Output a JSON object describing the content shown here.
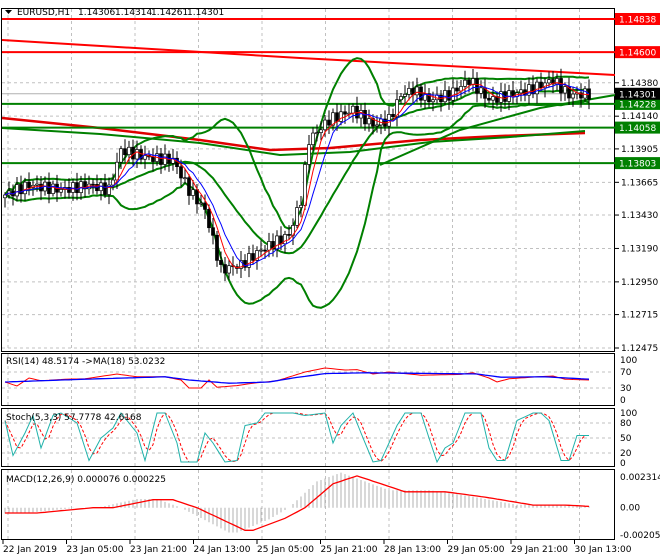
{
  "header": {
    "symbol": "EURUSD,H1",
    "open": "1.14306",
    "high": "1.14314",
    "low": "1.14261",
    "close": "1.14301"
  },
  "price_axis": {
    "ticks": [
      "1.14380",
      "1.14140",
      "1.13905",
      "1.13665",
      "1.13430",
      "1.13190",
      "1.12950",
      "1.12715",
      "1.12475"
    ],
    "tick_values": [
      1.1438,
      1.1414,
      1.13905,
      1.13665,
      1.1343,
      1.1319,
      1.1295,
      1.12715,
      1.12475
    ],
    "range": [
      1.12475,
      1.14838
    ]
  },
  "levels": [
    {
      "label": "1.14838",
      "value": 1.14838,
      "color": "#ff0000"
    },
    {
      "label": "1.14600",
      "value": 1.146,
      "color": "#ff0000"
    },
    {
      "label": "1.14228",
      "value": 1.14228,
      "color": "#008000"
    },
    {
      "label": "1.14058",
      "value": 1.14058,
      "color": "#008000"
    },
    {
      "label": "1.13803",
      "value": 1.13803,
      "color": "#008000"
    }
  ],
  "current_price": {
    "label": "1.14301",
    "value": 1.14301
  },
  "chart_data": {
    "type": "candlestick",
    "candle_count": 147,
    "close_keypoints": [
      [
        0,
        1.13574
      ],
      [
        6,
        1.13646
      ],
      [
        14,
        1.1361
      ],
      [
        21,
        1.13646
      ],
      [
        26,
        1.1361
      ],
      [
        29,
        1.13897
      ],
      [
        36,
        1.1384
      ],
      [
        42,
        1.13826
      ],
      [
        46,
        1.1361
      ],
      [
        50,
        1.13467
      ],
      [
        54,
        1.13036
      ],
      [
        59,
        1.13072
      ],
      [
        64,
        1.13179
      ],
      [
        71,
        1.13287
      ],
      [
        74,
        1.13538
      ],
      [
        76,
        1.13969
      ],
      [
        81,
        1.14113
      ],
      [
        87,
        1.14185
      ],
      [
        92,
        1.14077
      ],
      [
        96,
        1.14113
      ],
      [
        99,
        1.14292
      ],
      [
        102,
        1.14328
      ],
      [
        106,
        1.14256
      ],
      [
        111,
        1.14292
      ],
      [
        116,
        1.144
      ],
      [
        121,
        1.14256
      ],
      [
        126,
        1.14292
      ],
      [
        131,
        1.14328
      ],
      [
        137,
        1.144
      ],
      [
        141,
        1.14292
      ],
      [
        146,
        1.14301
      ]
    ],
    "rsi": {
      "label": "RSI(14) 48.5174  ->MA(18) 53.0232",
      "levels": [
        "100",
        "70",
        "30",
        "0"
      ],
      "values": [
        [
          0,
          45
        ],
        [
          3,
          35
        ],
        [
          6,
          55
        ],
        [
          9,
          48
        ],
        [
          15,
          52
        ],
        [
          20,
          53
        ],
        [
          28,
          65
        ],
        [
          33,
          58
        ],
        [
          40,
          58
        ],
        [
          44,
          50
        ],
        [
          46,
          30
        ],
        [
          49,
          30
        ],
        [
          51,
          50
        ],
        [
          53,
          32
        ],
        [
          58,
          36
        ],
        [
          62,
          42
        ],
        [
          68,
          48
        ],
        [
          75,
          70
        ],
        [
          80,
          80
        ],
        [
          85,
          75
        ],
        [
          88,
          76
        ],
        [
          92,
          65
        ],
        [
          96,
          70
        ],
        [
          104,
          62
        ],
        [
          114,
          64
        ],
        [
          117,
          68
        ],
        [
          121,
          55
        ],
        [
          123,
          45
        ],
        [
          126,
          53
        ],
        [
          133,
          58
        ],
        [
          137,
          60
        ],
        [
          140,
          52
        ],
        [
          146,
          50
        ]
      ],
      "ma": [
        [
          0,
          45
        ],
        [
          20,
          52
        ],
        [
          40,
          58
        ],
        [
          46,
          50
        ],
        [
          56,
          42
        ],
        [
          66,
          45
        ],
        [
          72,
          55
        ],
        [
          80,
          66
        ],
        [
          90,
          68
        ],
        [
          110,
          66
        ],
        [
          118,
          65
        ],
        [
          124,
          57
        ],
        [
          135,
          58
        ],
        [
          146,
          52
        ]
      ]
    },
    "stoch": {
      "label": "Stoch(5,3,3) 57.7778 42.6168",
      "levels": [
        "100",
        "80",
        "50",
        "20",
        "0"
      ],
      "main": [
        [
          0,
          85
        ],
        [
          2,
          15
        ],
        [
          5,
          60
        ],
        [
          7,
          95
        ],
        [
          9,
          30
        ],
        [
          12,
          95
        ],
        [
          14,
          100
        ],
        [
          18,
          80
        ],
        [
          21,
          5
        ],
        [
          24,
          50
        ],
        [
          27,
          70
        ],
        [
          29,
          100
        ],
        [
          33,
          60
        ],
        [
          35,
          5
        ],
        [
          38,
          100
        ],
        [
          40,
          100
        ],
        [
          43,
          40
        ],
        [
          44,
          2
        ],
        [
          48,
          2
        ],
        [
          50,
          60
        ],
        [
          52,
          40
        ],
        [
          55,
          2
        ],
        [
          58,
          5
        ],
        [
          60,
          75
        ],
        [
          63,
          80
        ],
        [
          65,
          100
        ],
        [
          72,
          100
        ],
        [
          75,
          95
        ],
        [
          80,
          100
        ],
        [
          82,
          40
        ],
        [
          84,
          75
        ],
        [
          87,
          100
        ],
        [
          89,
          60
        ],
        [
          92,
          2
        ],
        [
          94,
          5
        ],
        [
          98,
          75
        ],
        [
          100,
          100
        ],
        [
          104,
          100
        ],
        [
          106,
          50
        ],
        [
          108,
          2
        ],
        [
          110,
          30
        ],
        [
          112,
          40
        ],
        [
          115,
          100
        ],
        [
          119,
          100
        ],
        [
          121,
          30
        ],
        [
          123,
          5
        ],
        [
          125,
          5
        ],
        [
          128,
          85
        ],
        [
          132,
          100
        ],
        [
          134,
          100
        ],
        [
          136,
          85
        ],
        [
          139,
          5
        ],
        [
          141,
          5
        ],
        [
          143,
          55
        ]
      ]
    },
    "macd": {
      "label": "MACD(12,26,9) 0.000076 0.000225",
      "ticks": [
        "0.002314",
        "0.00",
        "-0.002056"
      ],
      "range": [
        -0.002056,
        0.002314
      ],
      "signal": [
        [
          0,
          -0.0004
        ],
        [
          8,
          -0.0004
        ],
        [
          15,
          -0.0002
        ],
        [
          22,
          0
        ],
        [
          27,
          0
        ],
        [
          37,
          0.0006
        ],
        [
          42,
          0.0006
        ],
        [
          48,
          0
        ],
        [
          60,
          -0.0017
        ],
        [
          62,
          -0.0017
        ],
        [
          70,
          -0.0008
        ],
        [
          75,
          0
        ],
        [
          82,
          0.0018
        ],
        [
          88,
          0.0024
        ],
        [
          100,
          0.0012
        ],
        [
          110,
          0.0012
        ],
        [
          120,
          0.0008
        ],
        [
          128,
          0.0004
        ],
        [
          132,
          0.0002
        ],
        [
          140,
          0.0002
        ],
        [
          146,
          0.0001
        ]
      ]
    },
    "time_labels": [
      "22 Jan 2019",
      "23 Jan 05:00",
      "23 Jan 21:00",
      "24 Jan 13:00",
      "25 Jan 05:00",
      "25 Jan 21:00",
      "28 Jan 13:00",
      "29 Jan 05:00",
      "29 Jan 21:00",
      "30 Jan 13:00"
    ]
  }
}
